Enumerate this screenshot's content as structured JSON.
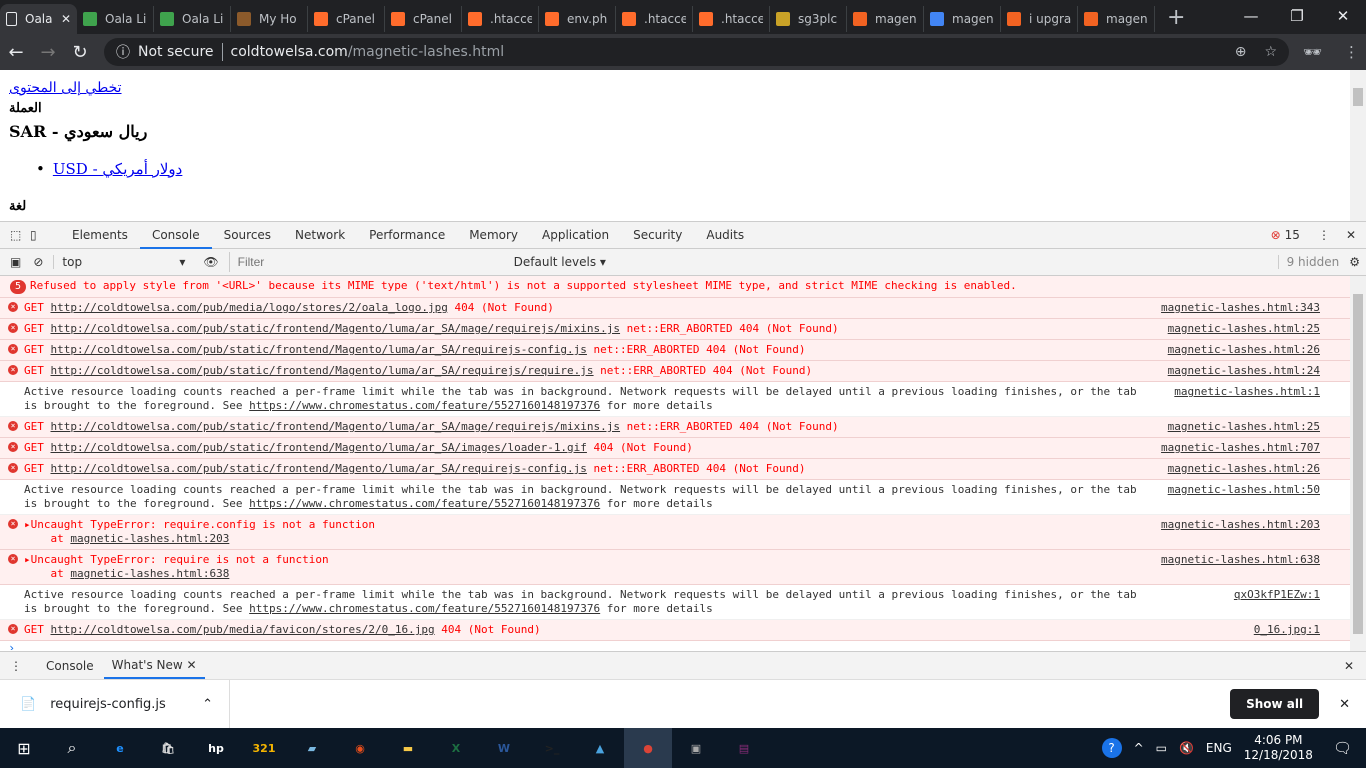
{
  "browser": {
    "tabs": [
      {
        "title": "Oala",
        "icon": "page-icon",
        "color": "#e8eaed",
        "active": true
      },
      {
        "title": "Oala Li",
        "icon": "oala-icon",
        "color": "#3fa34d"
      },
      {
        "title": "Oala Li",
        "icon": "oala-icon",
        "color": "#3fa34d"
      },
      {
        "title": "My Ho",
        "icon": "host-icon",
        "color": "#8b5a2b"
      },
      {
        "title": "cPanel",
        "icon": "cpanel-icon",
        "color": "#ff6c2c"
      },
      {
        "title": "cPanel",
        "icon": "cpanel-icon",
        "color": "#ff6c2c"
      },
      {
        "title": ".htacce",
        "icon": "cpanel-icon",
        "color": "#ff6c2c"
      },
      {
        "title": "env.ph",
        "icon": "cpanel-icon",
        "color": "#ff6c2c"
      },
      {
        "title": ".htacce",
        "icon": "cpanel-icon",
        "color": "#ff6c2c"
      },
      {
        "title": ".htacce",
        "icon": "cpanel-icon",
        "color": "#ff6c2c"
      },
      {
        "title": "sg3plc",
        "icon": "sg-icon",
        "color": "#c9a227"
      },
      {
        "title": "magen",
        "icon": "magento-icon",
        "color": "#f26322"
      },
      {
        "title": "magen",
        "icon": "google-icon",
        "color": "#4285f4"
      },
      {
        "title": "i upgra",
        "icon": "magento-icon",
        "color": "#f26322"
      },
      {
        "title": "magen",
        "icon": "magento-icon",
        "color": "#f26322"
      }
    ],
    "security": "Not secure",
    "url_host": "coldtowelsa.com",
    "url_path": "/magnetic-lashes.html"
  },
  "page": {
    "skip_link": "تخطي إلى المحتوى",
    "currency_label": "العملة",
    "currency_current": "SAR - ريال سعودي",
    "currency_option": "USD - دولار أمريكي",
    "language_label": "لغة"
  },
  "devtools": {
    "tabs": [
      "Elements",
      "Console",
      "Sources",
      "Network",
      "Performance",
      "Memory",
      "Application",
      "Security",
      "Audits"
    ],
    "active_tab": "Console",
    "error_count": "15",
    "context": "top",
    "filter_placeholder": "Filter",
    "levels": "Default levels",
    "hidden": "9 hidden",
    "messages": [
      {
        "type": "err",
        "group": "5",
        "text": "Refused to apply style from '<URL>' because its MIME type ('text/html') is not a supported stylesheet MIME type, and strict MIME checking is enabled.",
        "src": ""
      },
      {
        "type": "err",
        "pre": "GET ",
        "link": "http://coldtowelsa.com/pub/media/logo/stores/2/oala_logo.jpg",
        "post": " 404 (Not Found)",
        "src": "magnetic-lashes.html:343"
      },
      {
        "type": "err",
        "pre": "GET ",
        "link": "http://coldtowelsa.com/pub/static/frontend/Magento/luma/ar_SA/mage/requirejs/mixins.js",
        "post": " net::ERR_ABORTED 404 (Not Found)",
        "src": "magnetic-lashes.html:25"
      },
      {
        "type": "err",
        "pre": "GET ",
        "link": "http://coldtowelsa.com/pub/static/frontend/Magento/luma/ar_SA/requirejs-config.js",
        "post": " net::ERR_ABORTED 404 (Not Found)",
        "src": "magnetic-lashes.html:26"
      },
      {
        "type": "err",
        "pre": "GET ",
        "link": "http://coldtowelsa.com/pub/static/frontend/Magento/luma/ar_SA/requirejs/require.js",
        "post": " net::ERR_ABORTED 404 (Not Found)",
        "src": "magnetic-lashes.html:24"
      },
      {
        "type": "info",
        "pre": "Active resource loading counts reached a per-frame limit while the tab was in background. Network requests will be delayed until a previous loading finishes, or the tab is brought to the foreground. See ",
        "link": "https://www.chromestatus.com/feature/5527160148197376",
        "post": " for more details",
        "src": "magnetic-lashes.html:1"
      },
      {
        "type": "err",
        "pre": "GET ",
        "link": "http://coldtowelsa.com/pub/static/frontend/Magento/luma/ar_SA/mage/requirejs/mixins.js",
        "post": " net::ERR_ABORTED 404 (Not Found)",
        "src": "magnetic-lashes.html:25"
      },
      {
        "type": "err",
        "pre": "GET ",
        "link": "http://coldtowelsa.com/pub/static/frontend/Magento/luma/ar_SA/images/loader-1.gif",
        "post": " 404 (Not Found)",
        "src": "magnetic-lashes.html:707"
      },
      {
        "type": "err",
        "pre": "GET ",
        "link": "http://coldtowelsa.com/pub/static/frontend/Magento/luma/ar_SA/requirejs-config.js",
        "post": " net::ERR_ABORTED 404 (Not Found)",
        "src": "magnetic-lashes.html:26"
      },
      {
        "type": "info",
        "pre": "Active resource loading counts reached a per-frame limit while the tab was in background. Network requests will be delayed until a previous loading finishes, or the tab is brought to the foreground. See ",
        "link": "https://www.chromestatus.com/feature/5527160148197376",
        "post": " for more details",
        "src": "magnetic-lashes.html:50"
      },
      {
        "type": "err",
        "pre": "▸Uncaught TypeError: require.config is not a function\n    at ",
        "link": "magnetic-lashes.html:203",
        "post": "",
        "src": "magnetic-lashes.html:203"
      },
      {
        "type": "err",
        "pre": "▸Uncaught TypeError: require is not a function\n    at ",
        "link": "magnetic-lashes.html:638",
        "post": "",
        "src": "magnetic-lashes.html:638"
      },
      {
        "type": "info",
        "pre": "Active resource loading counts reached a per-frame limit while the tab was in background. Network requests will be delayed until a previous loading finishes, or the tab is brought to the foreground. See ",
        "link": "https://www.chromestatus.com/feature/5527160148197376",
        "post": " for more details",
        "src": "qxO3kfP1EZw:1"
      },
      {
        "type": "err",
        "pre": "GET ",
        "link": "http://coldtowelsa.com/pub/media/favicon/stores/2/0_16.jpg",
        "post": " 404 (Not Found)",
        "src": "0_16.jpg:1"
      }
    ],
    "drawer_tabs": [
      "Console",
      "What's New"
    ]
  },
  "downloads": {
    "file": "requirejs-config.js",
    "show_all": "Show all"
  },
  "taskbar": {
    "apps": [
      {
        "name": "edge",
        "color": "#1e90ff",
        "glyph": "e"
      },
      {
        "name": "store",
        "color": "#ddd",
        "glyph": "🛍"
      },
      {
        "name": "hp",
        "color": "#fff",
        "glyph": "hp"
      },
      {
        "name": "calendar",
        "color": "#f4b400",
        "glyph": "321"
      },
      {
        "name": "notes",
        "color": "#7ab8e0",
        "glyph": "▰"
      },
      {
        "name": "recorder",
        "color": "#e94e1b",
        "glyph": "◉"
      },
      {
        "name": "file-explorer",
        "color": "#f7c948",
        "glyph": "▬"
      },
      {
        "name": "excel",
        "color": "#1d6f42",
        "glyph": "X"
      },
      {
        "name": "word",
        "color": "#2b579a",
        "glyph": "W"
      },
      {
        "name": "cmd",
        "color": "#222",
        "glyph": ">_"
      },
      {
        "name": "photos",
        "color": "#4aa3df",
        "glyph": "▲"
      },
      {
        "name": "chrome",
        "color": "#db4437",
        "glyph": "●"
      },
      {
        "name": "network-tool",
        "color": "#aaa",
        "glyph": "▣"
      },
      {
        "name": "winrar",
        "color": "#8b2c7a",
        "glyph": "▤"
      }
    ],
    "language": "ENG",
    "time": "4:06 PM",
    "date": "12/18/2018"
  }
}
